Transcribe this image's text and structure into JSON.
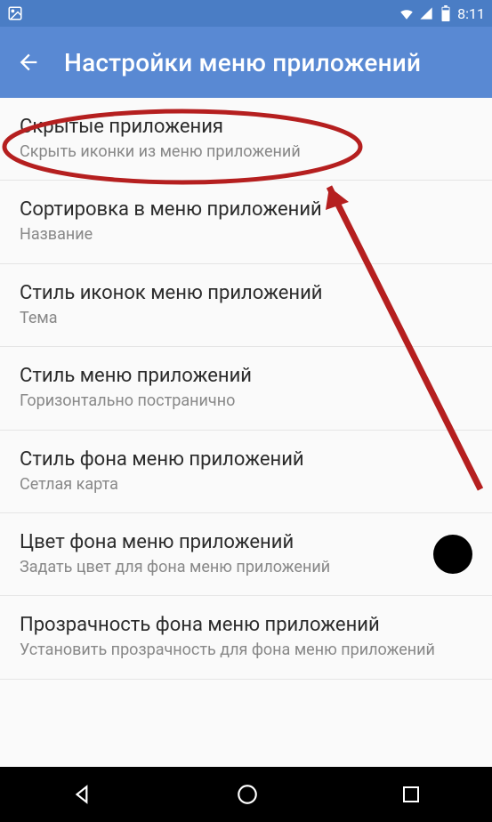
{
  "status_bar": {
    "time": "8:11"
  },
  "app_bar": {
    "title": "Настройки меню приложений"
  },
  "settings": [
    {
      "title": "Скрытые приложения",
      "subtitle": "Скрыть иконки из меню приложений"
    },
    {
      "title": "Сортировка в меню приложений",
      "subtitle": "Название"
    },
    {
      "title": "Стиль иконок меню приложений",
      "subtitle": "Тема"
    },
    {
      "title": "Стиль меню приложений",
      "subtitle": "Горизонтально постранично"
    },
    {
      "title": "Стиль фона меню приложений",
      "subtitle": "Сетлая карта"
    },
    {
      "title": "Цвет фона меню приложений",
      "subtitle": "Задать цвет для фона меню приложений",
      "swatch_color": "#000000"
    },
    {
      "title": "Прозрачность фона меню приложений",
      "subtitle": "Установить прозрачность для фона меню приложений"
    }
  ],
  "annotation": {
    "ellipse_stroke": "#b51f1f",
    "arrow_stroke": "#b51f1f"
  }
}
